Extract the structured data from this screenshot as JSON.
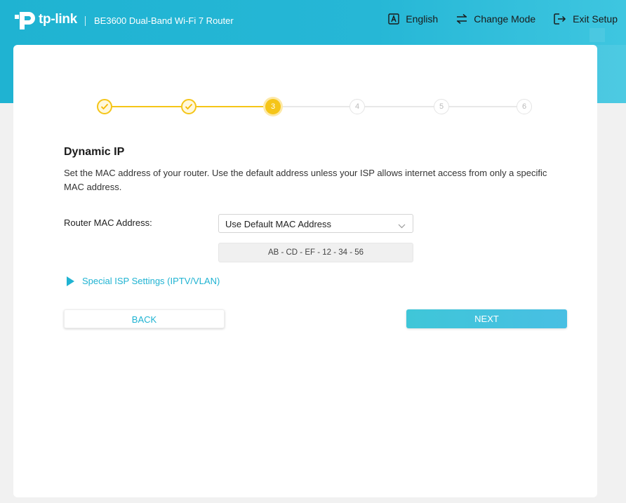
{
  "header": {
    "brand": "tp-link",
    "model": "BE3600 Dual-Band Wi-Fi 7 Router",
    "actions": [
      {
        "label": "English",
        "icon": "language-icon"
      },
      {
        "label": "Change Mode",
        "icon": "change-mode-icon"
      },
      {
        "label": "Exit Setup",
        "icon": "exit-setup-icon"
      }
    ]
  },
  "stepper": {
    "steps": [
      {
        "label": "",
        "state": "done"
      },
      {
        "label": "",
        "state": "done"
      },
      {
        "label": "3",
        "state": "active"
      },
      {
        "label": "4",
        "state": "todo"
      },
      {
        "label": "5",
        "state": "todo"
      },
      {
        "label": "6",
        "state": "todo"
      }
    ]
  },
  "content": {
    "title": "Dynamic IP",
    "description": "Set the MAC address of your router. Use the default address unless your ISP allows internet access from only a specific MAC address.",
    "mac_field": {
      "label": "Router MAC Address:",
      "selected": "Use Default MAC Address",
      "value": "AB - CD - EF - 12 - 34 - 56"
    },
    "special_isp_link": "Special ISP Settings (IPTV/VLAN)"
  },
  "buttons": {
    "back": "BACK",
    "next": "NEXT"
  },
  "colors": {
    "accent": "#1fb3d2",
    "step_active": "#f5c518"
  }
}
